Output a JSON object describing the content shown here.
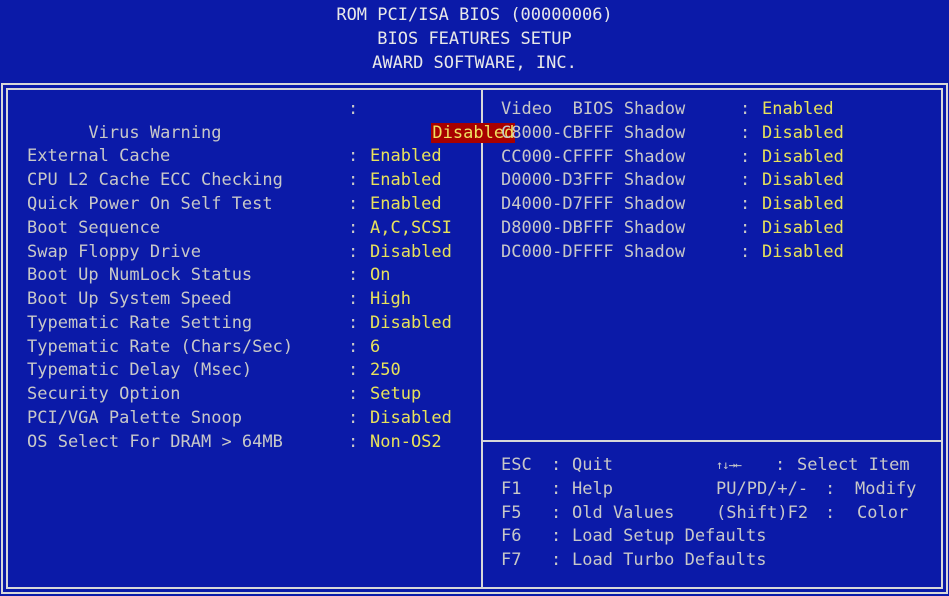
{
  "header": {
    "line1": "ROM PCI/ISA BIOS (00000006)",
    "line2": "BIOS FEATURES SETUP",
    "line3": "AWARD SOFTWARE, INC."
  },
  "left_settings": [
    {
      "label": "Virus Warning",
      "value": "Disabled",
      "selected": true
    },
    {
      "label": "External Cache",
      "value": "Enabled"
    },
    {
      "label": "CPU L2 Cache ECC Checking",
      "value": "Enabled"
    },
    {
      "label": "Quick Power On Self Test",
      "value": "Enabled"
    },
    {
      "label": "Boot Sequence",
      "value": "A,C,SCSI"
    },
    {
      "label": "Swap Floppy Drive",
      "value": "Disabled"
    },
    {
      "label": "Boot Up NumLock Status",
      "value": "On"
    },
    {
      "label": "Boot Up System Speed",
      "value": "High"
    },
    {
      "label": "Typematic Rate Setting",
      "value": "Disabled"
    },
    {
      "label": "Typematic Rate (Chars/Sec)",
      "value": "6"
    },
    {
      "label": "Typematic Delay (Msec)",
      "value": "250"
    },
    {
      "label": "Security Option",
      "value": "Setup"
    },
    {
      "label": "PCI/VGA Palette Snoop",
      "value": "Disabled"
    },
    {
      "label": "OS Select For DRAM > 64MB",
      "value": "Non-OS2"
    }
  ],
  "right_settings": [
    {
      "label": "Video  BIOS Shadow",
      "value": "Enabled"
    },
    {
      "label": "C8000-CBFFF Shadow",
      "value": "Disabled"
    },
    {
      "label": "CC000-CFFFF Shadow",
      "value": "Disabled"
    },
    {
      "label": "D0000-D3FFF Shadow",
      "value": "Disabled"
    },
    {
      "label": "D4000-D7FFF Shadow",
      "value": "Disabled"
    },
    {
      "label": "D8000-DBFFF Shadow",
      "value": "Disabled"
    },
    {
      "label": "DC000-DFFFF Shadow",
      "value": "Disabled"
    }
  ],
  "separator": ":",
  "help_keys": [
    {
      "key": "ESC",
      "action": "Quit"
    },
    {
      "key": "F1",
      "action": "Help"
    },
    {
      "key": "F5",
      "action": "Old Values"
    },
    {
      "key": "F6",
      "action": "Load Setup Defaults"
    },
    {
      "key": "F7",
      "action": "Load Turbo Defaults"
    }
  ],
  "help_keys_right": [
    {
      "key": "↑↓→←",
      "action": "Select Item"
    },
    {
      "key": "PU/PD/+/-",
      "action": "Modify"
    },
    {
      "key": "(Shift)F2",
      "action": "Color"
    }
  ],
  "colors": {
    "background": "#0b1aa8",
    "value_text": "#e8e25a",
    "label_text": "#c8c8c8",
    "highlight_bg": "#a80000"
  }
}
